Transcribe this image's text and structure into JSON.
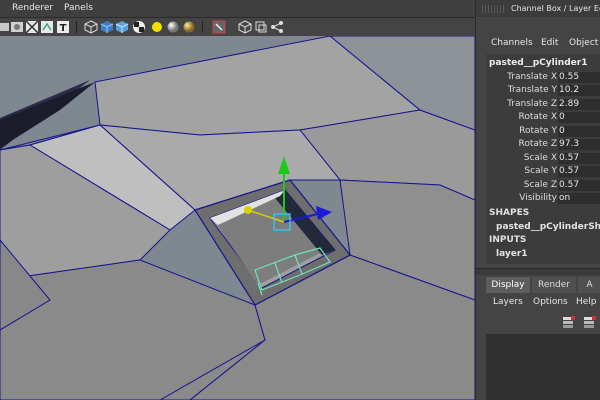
{
  "viewport": {
    "menu": [
      "Renderer",
      "Panels"
    ]
  },
  "toolbar": {
    "icons": [
      "select-camera-icon",
      "film-gate-icon",
      "grid-icon",
      "wireframe-icon",
      "texture-icon",
      "cube-icon",
      "shaded-cube-icon",
      "textured-cube-icon",
      "checker-icon",
      "light-icon",
      "sphere-icon",
      "shadow-sphere-icon",
      "isolate-select-icon",
      "xray-icon",
      "xray-joint-icon",
      "manipulator-icon"
    ]
  },
  "channel_box": {
    "title": "Channel Box / Layer Editor",
    "menu": [
      "Channels",
      "Edit",
      "Object"
    ],
    "object_name": "pasted__pCylinder1",
    "attributes": [
      {
        "label": "Translate X",
        "value": "0.55"
      },
      {
        "label": "Translate Y",
        "value": "10.2"
      },
      {
        "label": "Translate Z",
        "value": "2.89"
      },
      {
        "label": "Rotate X",
        "value": "0"
      },
      {
        "label": "Rotate Y",
        "value": "0"
      },
      {
        "label": "Rotate Z",
        "value": "97.3"
      },
      {
        "label": "Scale X",
        "value": "0.57"
      },
      {
        "label": "Scale Y",
        "value": "0.57"
      },
      {
        "label": "Scale Z",
        "value": "0.57"
      },
      {
        "label": "Visibility",
        "value": "on"
      }
    ],
    "shapes_header": "SHAPES",
    "shape_name": "pasted__pCylinderSha",
    "inputs_header": "INPUTS",
    "input_name": "layer1"
  },
  "layer_editor": {
    "tabs": [
      {
        "label": "Display",
        "active": true
      },
      {
        "label": "Render",
        "active": false
      },
      {
        "label": "A",
        "active": false
      }
    ],
    "menu": [
      "Layers",
      "Options",
      "Help"
    ]
  },
  "colors": {
    "wire": "#10108a",
    "selection": "#6fe3c0",
    "manip_y": "#1ec81e",
    "manip_x": "#d8d000",
    "manip_z": "#1a1ad8",
    "manip_center": "#30c8ff"
  }
}
